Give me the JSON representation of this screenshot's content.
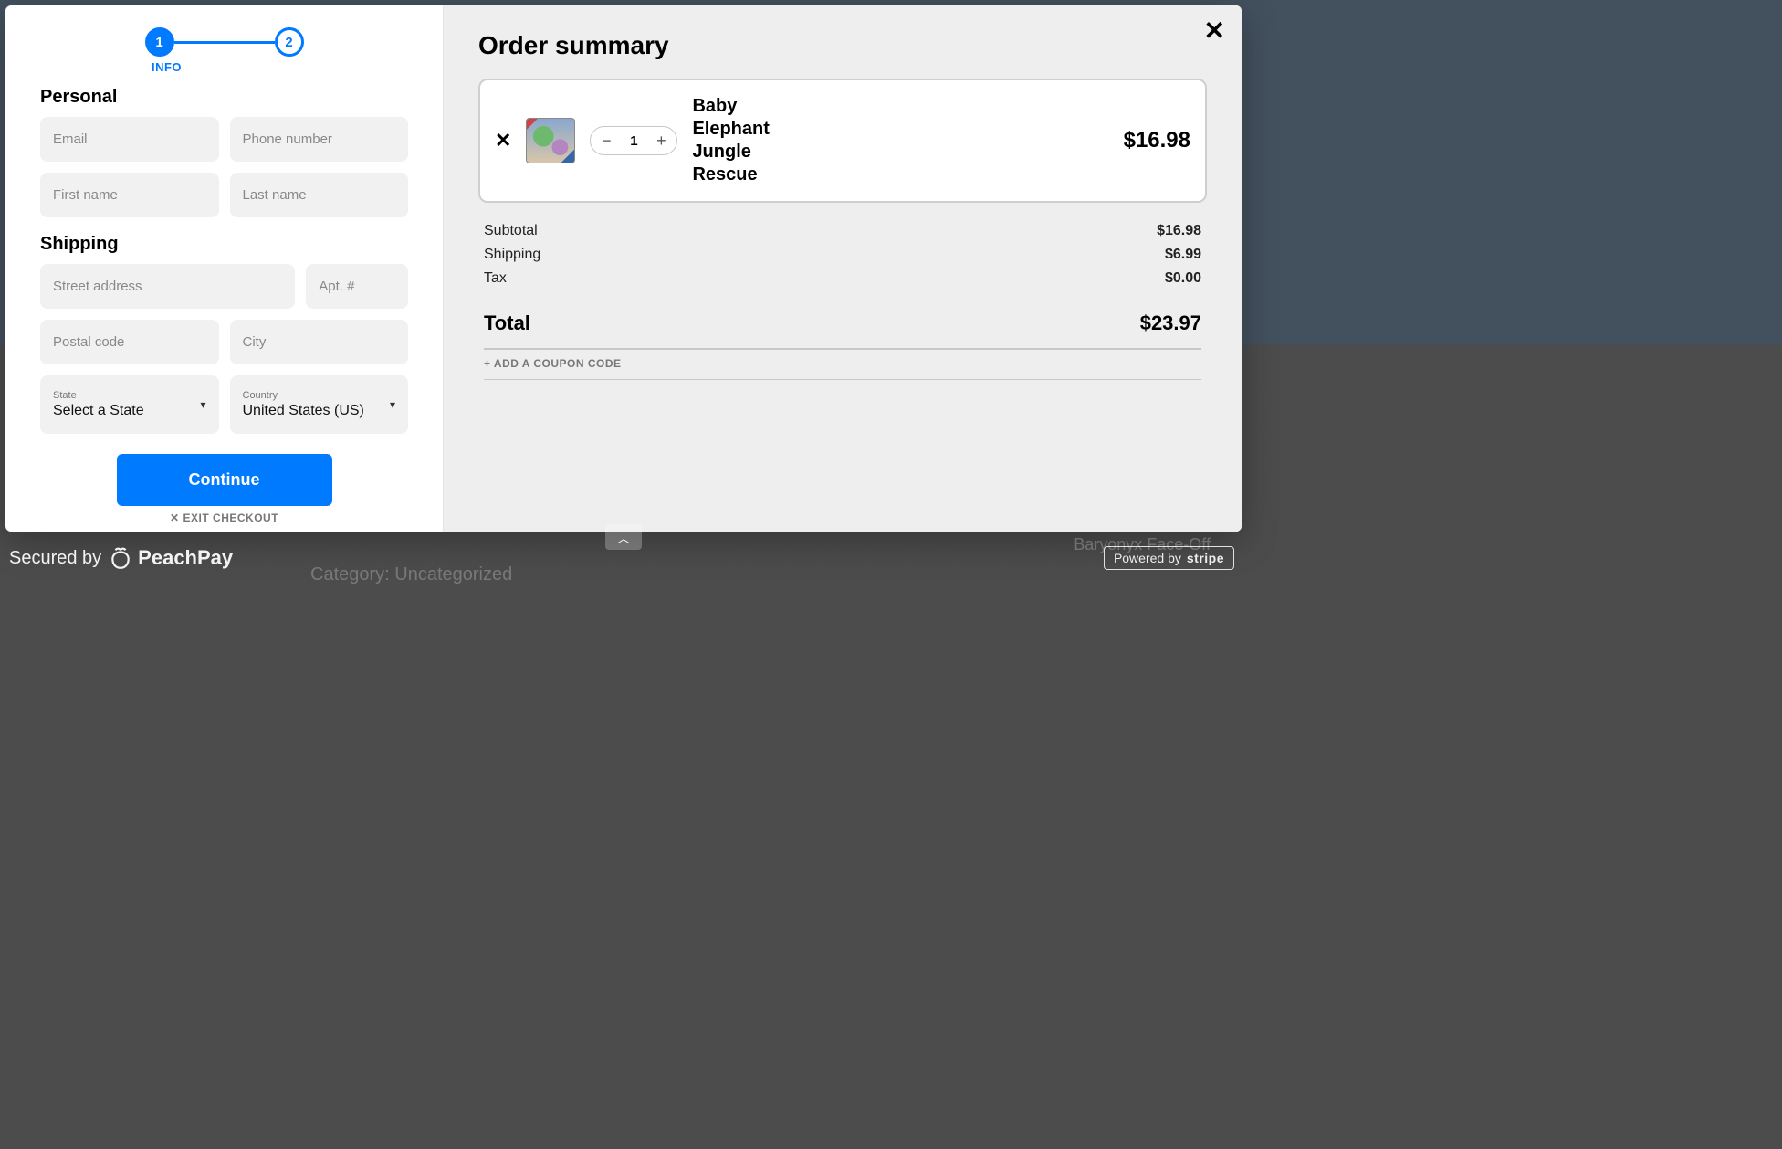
{
  "stepper": {
    "step1": "1",
    "step2": "2",
    "label": "INFO"
  },
  "sections": {
    "personal": "Personal",
    "shipping": "Shipping"
  },
  "placeholders": {
    "email": "Email",
    "phone": "Phone number",
    "first": "First name",
    "last": "Last name",
    "street": "Street address",
    "apt": "Apt. #",
    "postal": "Postal code",
    "city": "City"
  },
  "selects": {
    "state": {
      "label": "State",
      "value": "Select a State"
    },
    "country": {
      "label": "Country",
      "value": "United States (US)"
    }
  },
  "buttons": {
    "continue": "Continue",
    "exit": "EXIT CHECKOUT",
    "coupon": "+ ADD A COUPON CODE"
  },
  "summary": {
    "title": "Order summary",
    "item": {
      "name": "Baby Elephant Jungle Rescue",
      "qty": "1",
      "price": "$16.98"
    },
    "rows": {
      "subtotal": {
        "label": "Subtotal",
        "value": "$16.98"
      },
      "shipping": {
        "label": "Shipping",
        "value": "$6.99"
      },
      "tax": {
        "label": "Tax",
        "value": "$0.00"
      }
    },
    "total": {
      "label": "Total",
      "value": "$23.97"
    }
  },
  "footer": {
    "secured": "Secured by",
    "peachpay": "PeachPay",
    "powered": "Powered by",
    "stripe": "stripe"
  },
  "background": {
    "category": "Category: Uncategorized",
    "baryonyx": "Baryonyx Face-Off"
  },
  "colors": {
    "accent": "#007aff"
  }
}
